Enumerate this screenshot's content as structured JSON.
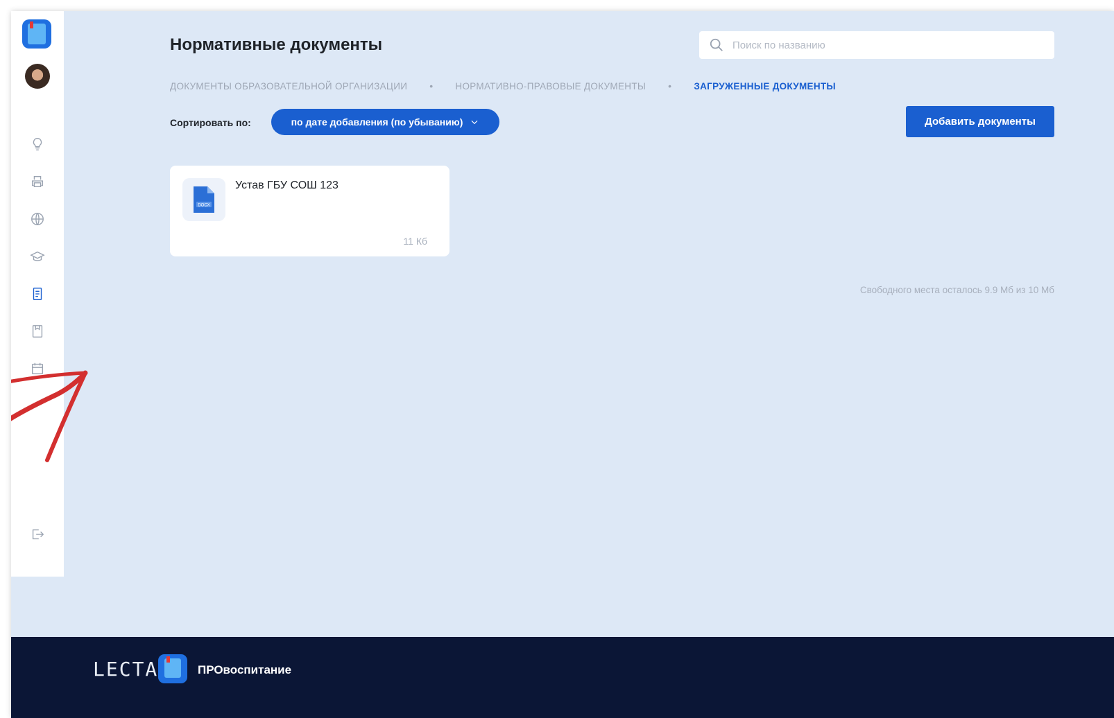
{
  "header": {
    "title": "Нормативные документы",
    "search_placeholder": "Поиск по названию"
  },
  "tabs": [
    {
      "label": "ДОКУМЕНТЫ ОБРАЗОВАТЕЛЬНОЙ ОРГАНИЗАЦИИ",
      "active": false
    },
    {
      "label": "НОРМАТИВНО-ПРАВОВЫЕ ДОКУМЕНТЫ",
      "active": false
    },
    {
      "label": "ЗАГРУЖЕННЫЕ ДОКУМЕНТЫ",
      "active": true
    }
  ],
  "tab_separator": "•",
  "sort": {
    "label": "Сортировать по:",
    "selected": "по дате добавления (по убыванию)"
  },
  "actions": {
    "add_documents": "Добавить документы"
  },
  "documents": [
    {
      "name": "Устав ГБУ СОШ 123",
      "size": "11 Кб",
      "file_type": "DOCX"
    }
  ],
  "storage": {
    "free_space": "Свободного места осталось 9.9 Мб из 10 Мб"
  },
  "sidebar": {
    "icons": [
      "lightbulb-icon",
      "printer-icon",
      "globe-icon",
      "graduation-cap-icon",
      "document-icon",
      "archive-icon",
      "calendar-icon"
    ],
    "active_icon": "document-icon",
    "logout_icon": "logout-icon"
  },
  "footer": {
    "brand": "LECTA",
    "product": "ПРОвоспитание"
  },
  "colors": {
    "accent": "#1a5fd0",
    "page_bg": "#dde8f6",
    "footer_bg": "#0b1636",
    "annotation_arrow": "#d32f2f"
  }
}
